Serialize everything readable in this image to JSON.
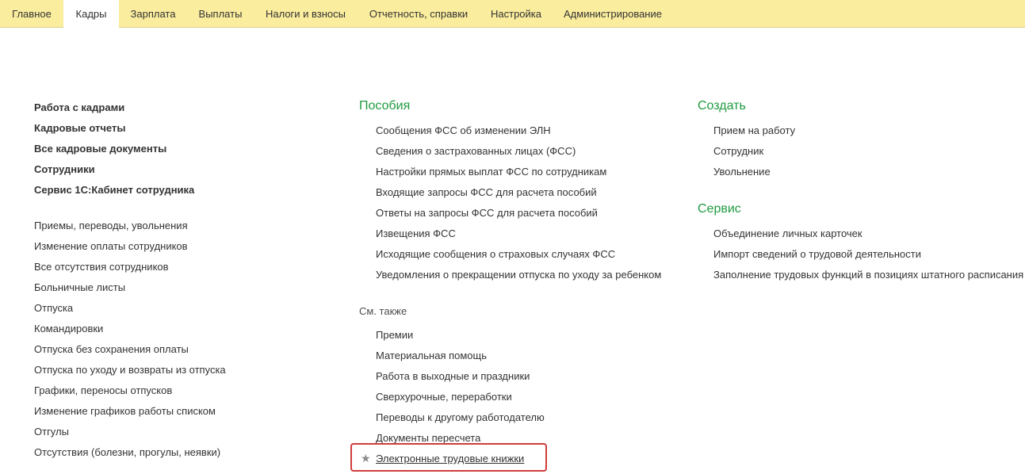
{
  "menu": {
    "tabs": [
      {
        "label": "Главное"
      },
      {
        "label": "Кадры",
        "active": true
      },
      {
        "label": "Зарплата"
      },
      {
        "label": "Выплаты"
      },
      {
        "label": "Налоги и взносы"
      },
      {
        "label": "Отчетность, справки"
      },
      {
        "label": "Настройка"
      },
      {
        "label": "Администрирование"
      }
    ]
  },
  "left": {
    "main_links": [
      "Работа с кадрами",
      "Кадровые отчеты",
      "Все кадровые документы",
      "Сотрудники",
      "Сервис 1С:Кабинет сотрудника"
    ],
    "links": [
      "Приемы, переводы, увольнения",
      "Изменение оплаты сотрудников",
      "Все отсутствия сотрудников",
      "Больничные листы",
      "Отпуска",
      "Командировки",
      "Отпуска без сохранения оплаты",
      "Отпуска по уходу и возвраты из отпуска",
      "Графики, переносы отпусков",
      "Изменение графиков работы списком",
      "Отгулы",
      "Отсутствия (болезни, прогулы, неявки)"
    ]
  },
  "middle": {
    "benefits_title": "Пособия",
    "benefits": [
      "Сообщения ФСС об изменении ЭЛН",
      "Сведения о застрахованных лицах (ФСС)",
      "Настройки прямых выплат ФСС по сотрудникам",
      "Входящие запросы ФСС для расчета пособий",
      "Ответы на запросы ФСС для расчета пособий",
      "Извещения ФСС",
      "Исходящие сообщения о страховых случаях ФСС",
      "Уведомления о прекращении отпуска по уходу за ребенком"
    ],
    "see_also_title": "См. также",
    "see_also": [
      "Премии",
      "Материальная помощь",
      "Работа в выходные и праздники",
      "Сверхурочные, переработки",
      "Переводы к другому работодателю",
      "Документы пересчета"
    ],
    "highlighted_link": "Электронные трудовые книжки"
  },
  "right": {
    "create_title": "Создать",
    "create": [
      "Прием на работу",
      "Сотрудник",
      "Увольнение"
    ],
    "service_title": "Сервис",
    "service": [
      "Объединение личных карточек",
      "Импорт сведений о трудовой деятельности",
      "Заполнение трудовых функций в позициях штатного расписания"
    ]
  },
  "colors": {
    "menubar": "#fbed9e",
    "group_title": "#1f9b40",
    "highlight_border": "#d13c3c"
  }
}
